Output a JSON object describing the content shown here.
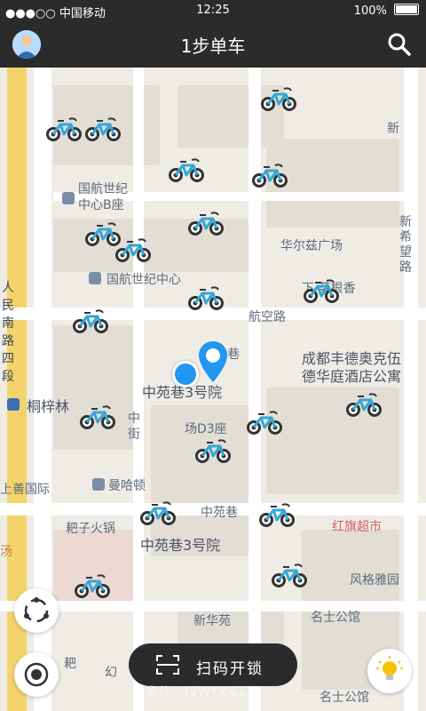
{
  "status_bar": {
    "carrier": "●●●○○ 中国移动",
    "time": "12:25",
    "battery": "100%"
  },
  "nav": {
    "title": "1步单车"
  },
  "map": {
    "labels": {
      "cbd_b": "国航世纪\n中心B座",
      "cbd": "国航世纪中心",
      "huaerzi": "华尔兹广场",
      "hangkong": "航空路",
      "xiacaigen": "下   菜根香",
      "chengdu": "成都丰德奥克伍\n德华庭酒店公寓",
      "zhongyuan1": "中苑巷3号院",
      "xiang": "巷",
      "tongzilin": "桐梓林",
      "d3": "场D3座",
      "zhong": "中\n街",
      "manhadun": "曼哈顿",
      "shangshan": "上善国际",
      "bazi": "耙子火锅",
      "zhongyuanxiang": "中苑巷",
      "zhongyuan2": "中苑巷3号院",
      "hongqi": "红旗超市",
      "fengge": "风格雅园",
      "xinhuayuan": "新华苑",
      "mingshi1": "名士公馆",
      "mingshi2": "名士公馆",
      "renmin": "人\n民\n南\n路\n四\n段",
      "xinxi": "新\n希\n望\n路",
      "xin": "新",
      "tang": "汤",
      "ba": "耙",
      "huan": "幻"
    }
  },
  "scan_button": {
    "label": "扫码开锁"
  },
  "watermark": "玩意儿 · 11WYX.CC",
  "icons": {
    "avatar": "user-avatar-icon",
    "search": "search-icon",
    "location": "location-pin-icon",
    "bike": "bike-icon",
    "recenter": "recenter-icon",
    "refresh": "refresh-icon",
    "lightbulb": "lightbulb-icon",
    "scan": "scan-icon"
  },
  "colors": {
    "bar": "#2b2b2b",
    "pin": "#2196f3",
    "bike_blue": "#35a7d6"
  }
}
